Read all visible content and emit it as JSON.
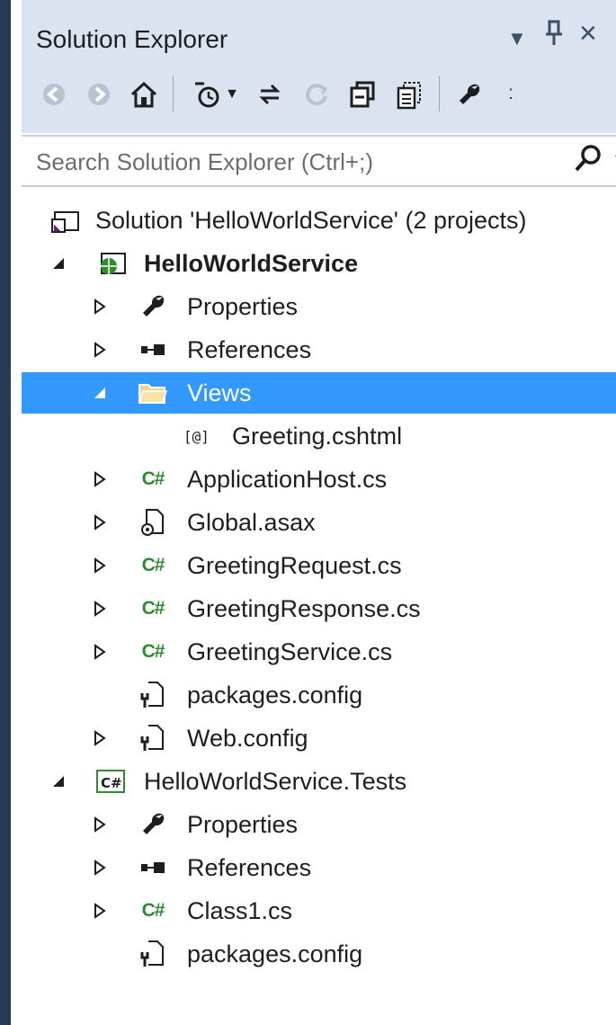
{
  "panel": {
    "title": "Solution Explorer",
    "pin_glyph": "1",
    "close_glyph": "×"
  },
  "toolbar": {
    "icons": [
      "back-icon",
      "forward-icon",
      "home-icon",
      "pending-changes-icon",
      "sync-icon",
      "refresh-icon",
      "collapse-all-icon",
      "show-all-files-icon",
      "properties-icon"
    ]
  },
  "search": {
    "placeholder": "Search Solution Explorer (Ctrl+;)",
    "value": ""
  },
  "tree": {
    "solution": "Solution 'HelloWorldService' (2 projects)",
    "project1": {
      "name": "HelloWorldService",
      "properties": "Properties",
      "references": "References",
      "views": "Views",
      "greeting_view": "Greeting.cshtml",
      "application_host": "ApplicationHost.cs",
      "global_asax": "Global.asax",
      "greeting_request": "GreetingRequest.cs",
      "greeting_response": "GreetingResponse.cs",
      "greeting_service": "GreetingService.cs",
      "packages_config": "packages.config",
      "web_config": "Web.config"
    },
    "project2": {
      "name": "HelloWorldService.Tests",
      "properties": "Properties",
      "references": "References",
      "class1": "Class1.cs",
      "packages_config": "packages.config"
    },
    "cs_glyph": "C#",
    "selected_color": "#3399ff"
  }
}
